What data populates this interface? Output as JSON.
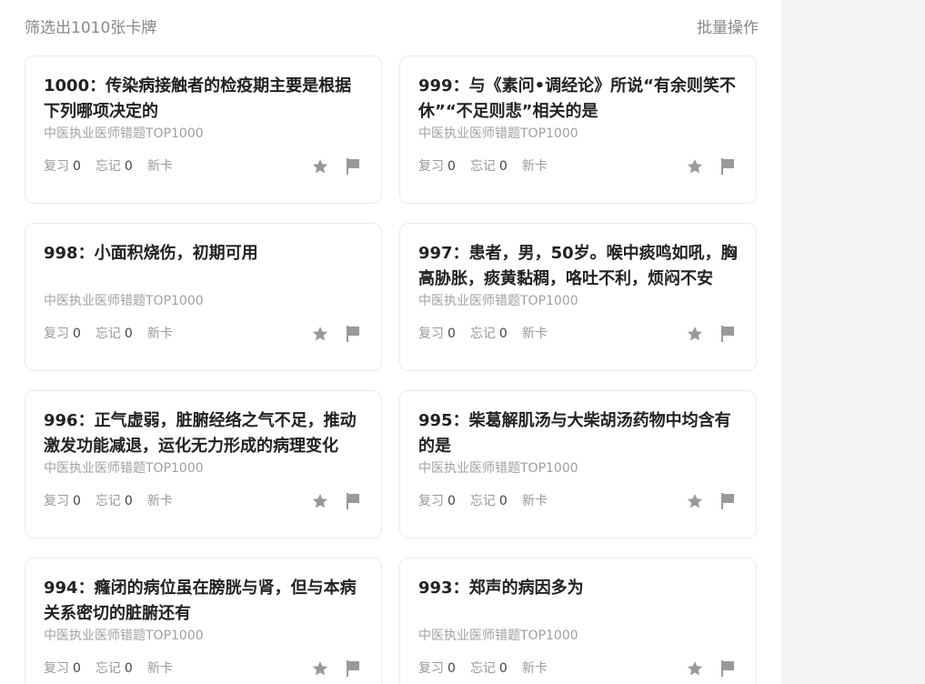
{
  "header": {
    "filter_count": "筛选出1010张卡牌",
    "batch_action": "批量操作"
  },
  "icons": {
    "favorite": "star-icon",
    "report": "flag-icon"
  },
  "colors": {
    "icon": "#999999",
    "title": "#222222",
    "muted": "#a0a0a0"
  },
  "cards": [
    {
      "title": "1000：传染病接触者的检疫期主要是根据下列哪项决定的",
      "deck": "中医执业医师错题TOP1000",
      "review_label": "复习",
      "review_count": "0",
      "forget_label": "忘记",
      "forget_count": "0",
      "status": "新卡"
    },
    {
      "title": "999：与《素问•调经论》所说“有余则笑不休”“不足则悲”相关的是",
      "deck": "中医执业医师错题TOP1000",
      "review_label": "复习",
      "review_count": "0",
      "forget_label": "忘记",
      "forget_count": "0",
      "status": "新卡"
    },
    {
      "title": "998：小面积烧伤，初期可用",
      "deck": "中医执业医师错题TOP1000",
      "review_label": "复习",
      "review_count": "0",
      "forget_label": "忘记",
      "forget_count": "0",
      "status": "新卡"
    },
    {
      "title": "997：患者，男，50岁。喉中痰鸣如吼，胸高胁胀，痰黄黏稠，咯吐不利，烦闷不安",
      "deck": "中医执业医师错题TOP1000",
      "review_label": "复习",
      "review_count": "0",
      "forget_label": "忘记",
      "forget_count": "0",
      "status": "新卡"
    },
    {
      "title": "996：正气虚弱，脏腑经络之气不足，推动激发功能减退，运化无力形成的病理变化",
      "deck": "中医执业医师错题TOP1000",
      "review_label": "复习",
      "review_count": "0",
      "forget_label": "忘记",
      "forget_count": "0",
      "status": "新卡"
    },
    {
      "title": "995：柴葛解肌汤与大柴胡汤药物中均含有的是",
      "deck": "中医执业医师错题TOP1000",
      "review_label": "复习",
      "review_count": "0",
      "forget_label": "忘记",
      "forget_count": "0",
      "status": "新卡"
    },
    {
      "title": "994：癃闭的病位虽在膀胱与肾，但与本病关系密切的脏腑还有",
      "deck": "中医执业医师错题TOP1000",
      "review_label": "复习",
      "review_count": "0",
      "forget_label": "忘记",
      "forget_count": "0",
      "status": "新卡"
    },
    {
      "title": "993：郑声的病因多为",
      "deck": "中医执业医师错题TOP1000",
      "review_label": "复习",
      "review_count": "0",
      "forget_label": "忘记",
      "forget_count": "0",
      "status": "新卡"
    }
  ]
}
